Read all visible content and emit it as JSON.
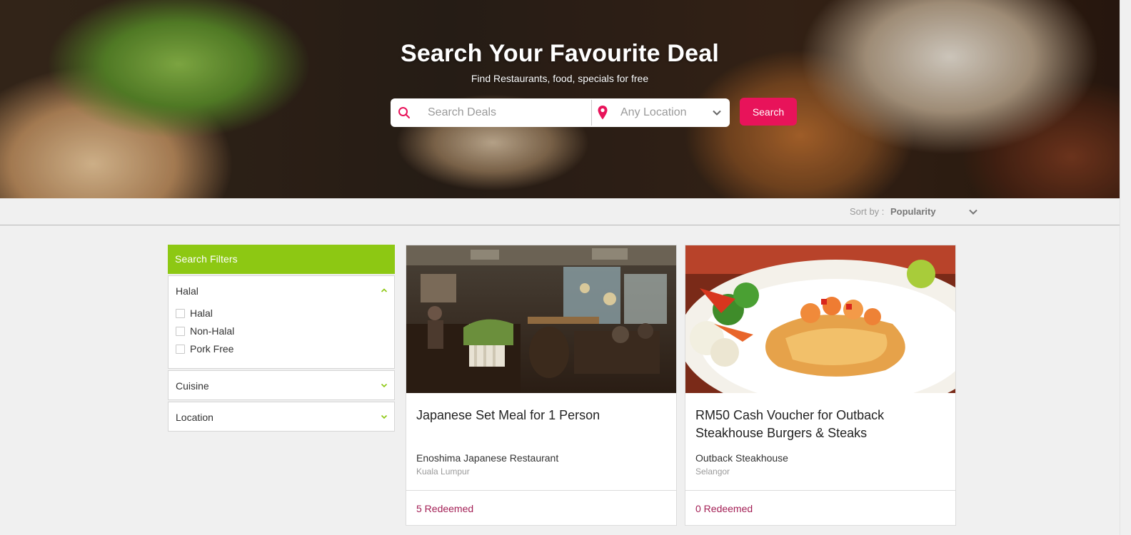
{
  "hero": {
    "title": "Search Your Favourite Deal",
    "subtitle": "Find Restaurants, food, specials for free"
  },
  "search": {
    "placeholder": "Search Deals",
    "location": "Any Location",
    "button_label": "Search",
    "accent_color": "#e8135a"
  },
  "sort": {
    "label": "Sort by :",
    "value": "Popularity"
  },
  "filters": {
    "header": "Search Filters",
    "header_color": "#8dc813",
    "panels": [
      {
        "label": "Halal",
        "expanded": true,
        "options": [
          "Halal",
          "Non-Halal",
          "Pork Free"
        ]
      },
      {
        "label": "Cuisine",
        "expanded": false
      },
      {
        "label": "Location",
        "expanded": false
      }
    ]
  },
  "deals": [
    {
      "title": "Japanese Set Meal for 1 Person",
      "merchant": "Enoshima Japanese Restaurant",
      "city": "Kuala Lumpur",
      "redeemed": "5 Redeemed"
    },
    {
      "title": "RM50 Cash Voucher for Outback Steakhouse Burgers & Steaks",
      "merchant": "Outback Steakhouse",
      "city": "Selangor",
      "redeemed": "0 Redeemed"
    }
  ]
}
